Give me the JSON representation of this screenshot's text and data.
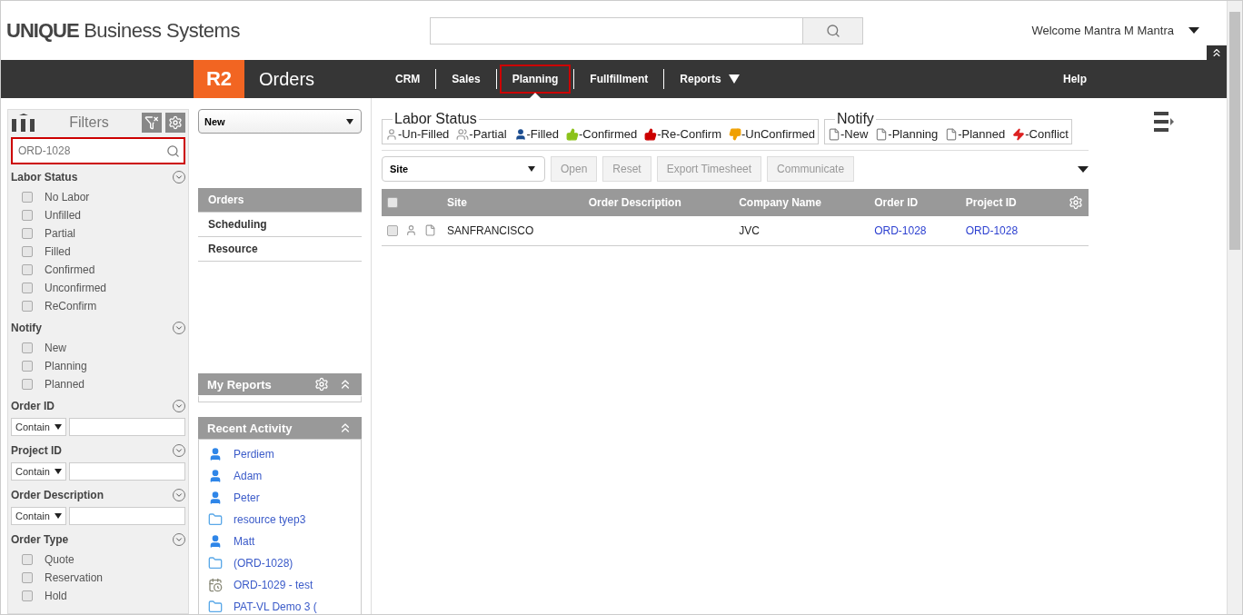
{
  "header": {
    "logo": "**UNIQUE** Business Systems",
    "welcome": "Welcome Mantra M Mantra"
  },
  "navbar": {
    "badge": "R2",
    "title": "Orders",
    "items": [
      {
        "label": "CRM",
        "selected": false,
        "dropdown": false
      },
      {
        "label": "Sales",
        "selected": false,
        "dropdown": false
      },
      {
        "label": "Planning",
        "selected": true,
        "dropdown": false
      },
      {
        "label": "Fullfillment",
        "selected": false,
        "dropdown": false
      },
      {
        "label": "Reports",
        "selected": false,
        "dropdown": true
      }
    ],
    "help": "Help"
  },
  "filters": {
    "title": "Filters",
    "search_value": "ORD-1028",
    "sections": [
      {
        "title": "Labor Status",
        "kind": "checkboxes",
        "items": [
          {
            "label": "No Labor",
            "checked": false
          },
          {
            "label": "Unfilled",
            "checked": false
          },
          {
            "label": "Partial",
            "checked": false
          },
          {
            "label": "Filled",
            "checked": false
          },
          {
            "label": "Confirmed",
            "checked": false
          },
          {
            "label": "Unconfirmed",
            "checked": false
          },
          {
            "label": "ReConfirm",
            "checked": false
          }
        ]
      },
      {
        "title": "Notify",
        "kind": "checkboxes",
        "items": [
          {
            "label": "New",
            "checked": false
          },
          {
            "label": "Planning",
            "checked": false
          },
          {
            "label": "Planned",
            "checked": false
          }
        ]
      },
      {
        "title": "Order ID",
        "kind": "text",
        "operator": "Contain"
      },
      {
        "title": "Project ID",
        "kind": "text",
        "operator": "Contain"
      },
      {
        "title": "Order Description",
        "kind": "text",
        "operator": "Contain"
      },
      {
        "title": "Order Type",
        "kind": "checkboxes",
        "items": [
          {
            "label": "Quote",
            "checked": false
          },
          {
            "label": "Reservation",
            "checked": false
          },
          {
            "label": "Hold",
            "checked": false
          }
        ]
      }
    ]
  },
  "middle": {
    "new_select": "New",
    "nav": [
      {
        "label": "Orders",
        "selected": true
      },
      {
        "label": "Scheduling",
        "selected": false
      },
      {
        "label": "Resource",
        "selected": false
      }
    ],
    "my_reports": {
      "title": "My Reports"
    },
    "recent_activity": {
      "title": "Recent Activity",
      "items": [
        {
          "label": "Perdiem",
          "kind": "person"
        },
        {
          "label": "Adam",
          "kind": "person"
        },
        {
          "label": "Peter",
          "kind": "person"
        },
        {
          "label": "resource tyep3",
          "kind": "folder"
        },
        {
          "label": "Matt",
          "kind": "person"
        },
        {
          "label": "(ORD-1028)",
          "kind": "folder"
        },
        {
          "label": "ORD-1029 - test",
          "kind": "calendar"
        },
        {
          "label": "PAT-VL Demo 3 (",
          "kind": "folder"
        }
      ]
    }
  },
  "legend": {
    "labor_title": "Labor Status",
    "labor": [
      {
        "label": "-Un-Filled",
        "kind": "unfilled"
      },
      {
        "label": "-Partial",
        "kind": "partial"
      },
      {
        "label": "-Filled",
        "kind": "filled"
      },
      {
        "label": "-Confirmed",
        "kind": "confirmed"
      },
      {
        "label": "-Re-Confirm",
        "kind": "reconfirm"
      },
      {
        "label": "-UnConfirmed",
        "kind": "unconfirmed"
      }
    ],
    "notify_title": "Notify",
    "notify": [
      {
        "label": "-New",
        "kind": "doc"
      },
      {
        "label": "-Planning",
        "kind": "doc"
      },
      {
        "label": "-Planned",
        "kind": "doc"
      },
      {
        "label": "-Conflict",
        "kind": "conflict"
      }
    ]
  },
  "toolbar": {
    "select": "Site",
    "buttons": [
      {
        "label": "Open",
        "disabled": true
      },
      {
        "label": "Reset",
        "disabled": true
      },
      {
        "label": "Export Timesheet",
        "disabled": true
      },
      {
        "label": "Communicate",
        "disabled": true
      }
    ]
  },
  "table": {
    "columns": [
      "Site",
      "Order Description",
      "Company Name",
      "Order ID",
      "Project ID"
    ],
    "all_checked": false,
    "rows": [
      {
        "checked": false,
        "site": "SANFRANCISCO",
        "company": "JVC",
        "order_id": "ORD-1028",
        "project_id": "ORD-1028"
      }
    ]
  }
}
